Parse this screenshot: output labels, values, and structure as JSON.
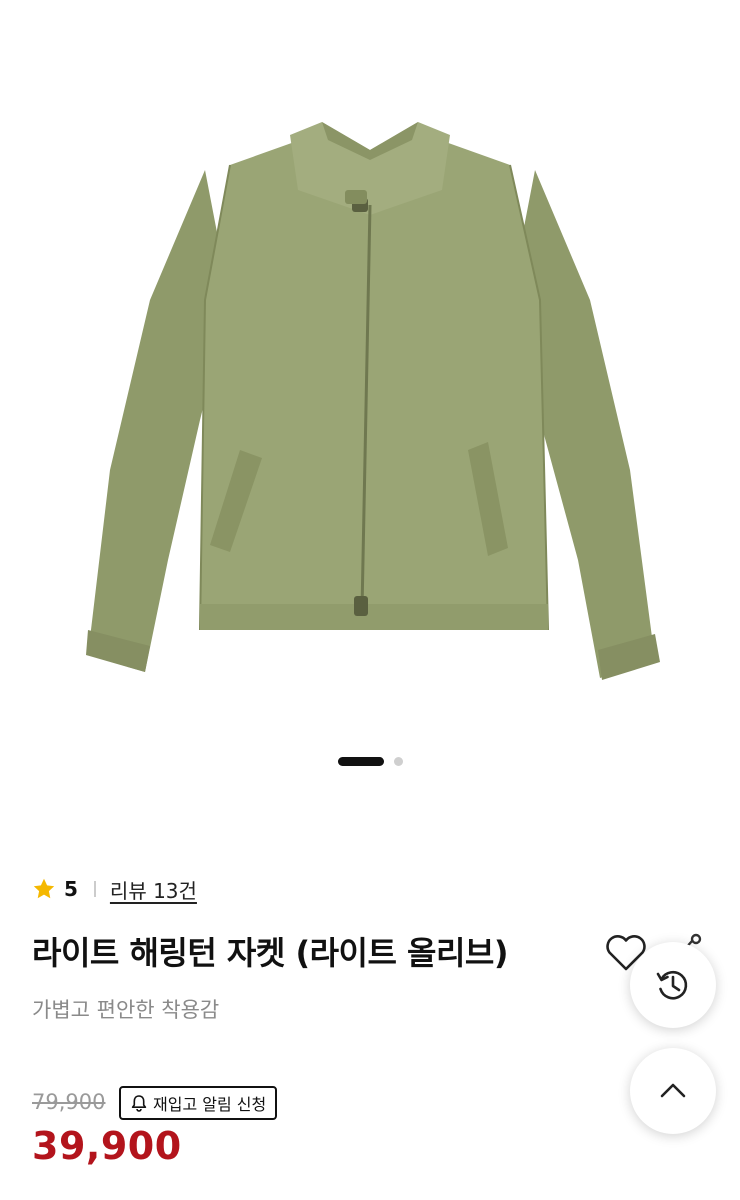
{
  "product": {
    "image_alt": "olive zip-up harrington jacket",
    "image_count": 2,
    "active_image": 1,
    "colors": {
      "jacket": "#98a373",
      "rating_star": "#f5b800",
      "sale_price": "#b3141c"
    }
  },
  "rating": {
    "score": "5",
    "review_link": "리뷰 13건"
  },
  "title": "라이트 해링턴 자켓 (라이트 올리브)",
  "subtitle": "가볍고 편안한 착용감",
  "price": {
    "original": "79,900",
    "sale": "39,900"
  },
  "restock": {
    "label": "재입고 알림 신청",
    "icon": "bell-icon"
  },
  "actions": {
    "wishlist_icon": "heart-icon",
    "share_icon": "share-icon",
    "history_icon": "history-icon",
    "scroll_top_icon": "chevron-up-icon"
  }
}
